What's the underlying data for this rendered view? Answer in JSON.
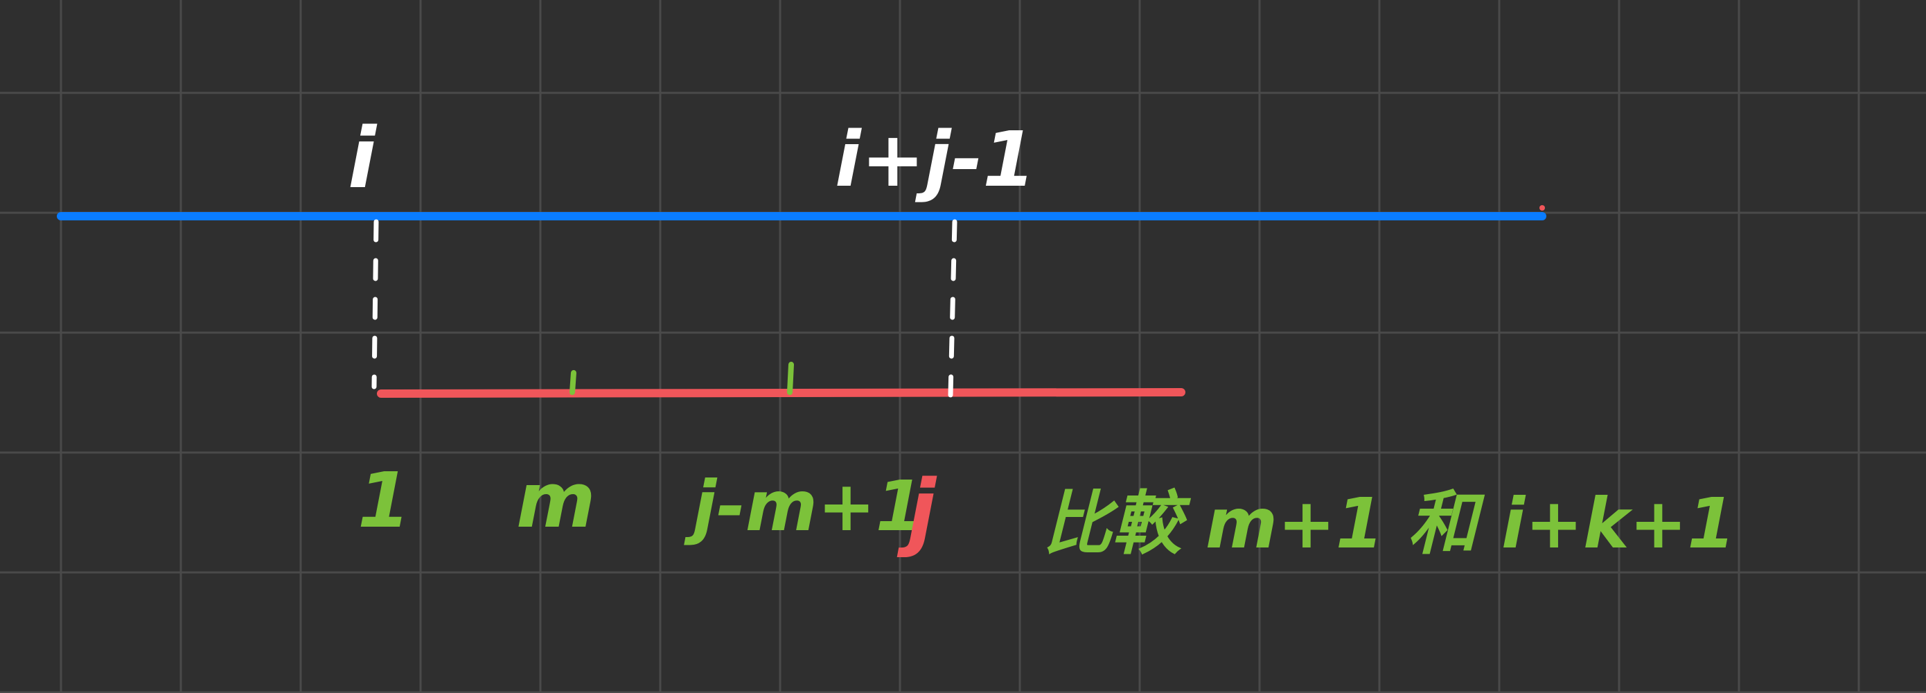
{
  "colors": {
    "background": "#2f2f2f",
    "grid": "#4a4a4a",
    "blue_line": "#0a7cff",
    "red_line": "#f0565a",
    "white_text": "#ffffff",
    "green_text": "#7cc23a",
    "red_text": "#f0565a"
  },
  "labels": {
    "top_i": "i",
    "top_i_j_1": "i+j-1",
    "bottom_1": "1",
    "bottom_m": "m",
    "bottom_j_m_1": "j-m+1",
    "bottom_j": "j",
    "bottom_note": "比較 m+1 和 i+k+1"
  },
  "icons": {
    "dashed_connector": "dashed-vertical-line"
  }
}
